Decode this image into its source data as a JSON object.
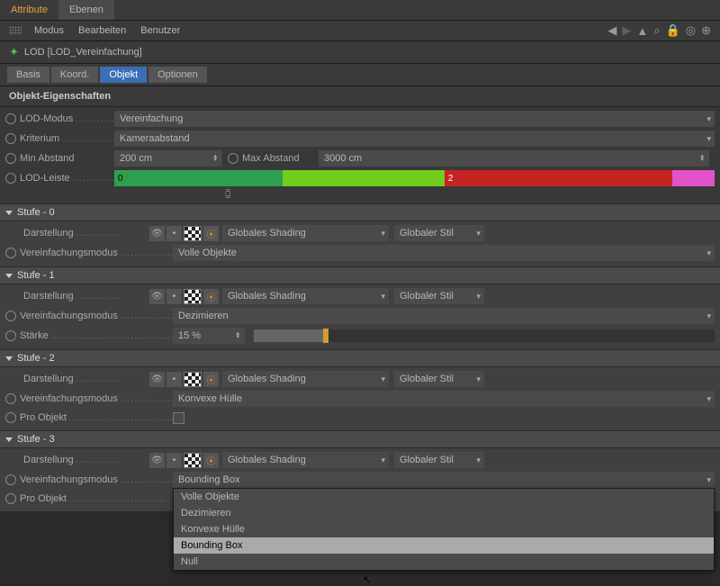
{
  "topTabs": {
    "attribute": "Attribute",
    "ebenen": "Ebenen"
  },
  "menubar": {
    "modus": "Modus",
    "bearbeiten": "Bearbeiten",
    "benutzer": "Benutzer"
  },
  "breadcrumb": "LOD [LOD_Vereinfachung]",
  "subtabs": {
    "basis": "Basis",
    "koord": "Koord.",
    "objekt": "Objekt",
    "optionen": "Optionen"
  },
  "section": "Objekt-Eigenschaften",
  "props": {
    "lodModusLabel": "LOD-Modus",
    "lodModus": "Vereinfachung",
    "kriteriumLabel": "Kriterium",
    "kriterium": "Kameraabstand",
    "minAbstandLabel": "Min Abstand",
    "minAbstand": "200 cm",
    "maxAbstandLabel": "Max Abstand",
    "maxAbstand": "3000 cm",
    "lodLeisteLabel": "LOD-Leiste",
    "lodBar": {
      "seg0": "0",
      "seg2": "2"
    }
  },
  "stufen": [
    {
      "title": "Stufe - 0",
      "darstellungLabel": "Darstellung",
      "shading": "Globales Shading",
      "stil": "Globaler Stil",
      "vereinfLabel": "Vereinfachungsmodus",
      "vereinf": "Volle Objekte"
    },
    {
      "title": "Stufe - 1",
      "darstellungLabel": "Darstellung",
      "shading": "Globales Shading",
      "stil": "Globaler Stil",
      "vereinfLabel": "Vereinfachungsmodus",
      "vereinf": "Dezimieren",
      "staerkeLabel": "Stärke",
      "staerke": "15 %",
      "staerkePct": 15
    },
    {
      "title": "Stufe - 2",
      "darstellungLabel": "Darstellung",
      "shading": "Globales Shading",
      "stil": "Globaler Stil",
      "vereinfLabel": "Vereinfachungsmodus",
      "vereinf": "Konvexe Hülle",
      "proObjLabel": "Pro Objekt"
    },
    {
      "title": "Stufe - 3",
      "darstellungLabel": "Darstellung",
      "shading": "Globales Shading",
      "stil": "Globaler Stil",
      "vereinfLabel": "Vereinfachungsmodus",
      "vereinf": "Bounding Box",
      "proObjLabel": "Pro Objekt",
      "menu": [
        "Volle Objekte",
        "Dezimieren",
        "Konvexe Hülle",
        "Bounding Box",
        "Null"
      ],
      "menuSelected": 3
    }
  ]
}
